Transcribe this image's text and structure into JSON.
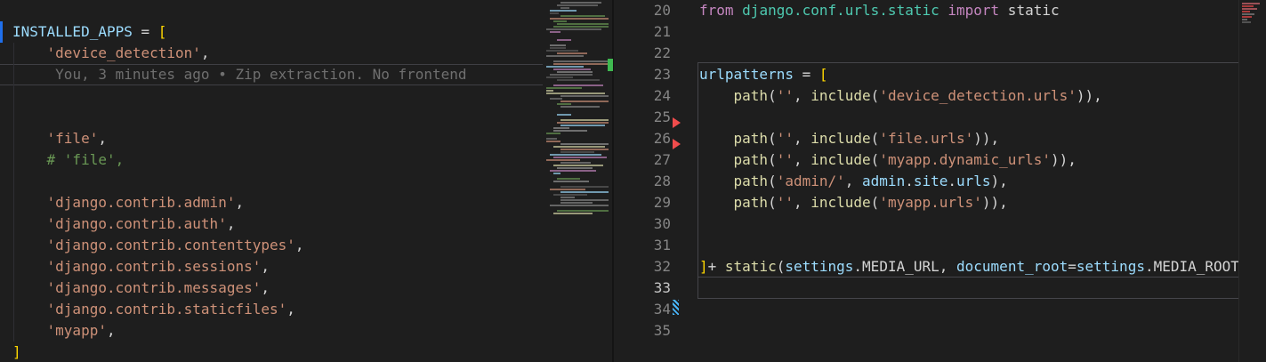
{
  "editor": {
    "background": "#1e1e1e",
    "colors": {
      "kw": "#C586C0",
      "str": "#CE9178",
      "com": "#6A9955",
      "var": "#9CDCFE",
      "fn": "#DCDCAA",
      "pn": "#D4D4D4",
      "br": "#FFD700",
      "mod": "#4EC9B0",
      "blame": "#6f6f6f",
      "line_number": "#858585",
      "line_number_active": "#C6C6C6",
      "git_added": "#3fb950",
      "git_modified": "#1f6feb",
      "git_deleted": "#f14c4c"
    },
    "left_pane": {
      "blame_text": "You, 3 minutes ago • Zip extraction. No frontend",
      "lines": [
        {
          "tokens": []
        },
        {
          "tokens": [
            [
              "INSTALLED_APPS",
              "var"
            ],
            [
              " = ",
              "pn"
            ],
            [
              "[",
              "br"
            ]
          ]
        },
        {
          "tokens": [
            [
              "    ",
              "pn"
            ],
            [
              "'device_detection'",
              "str"
            ],
            [
              ",",
              "pn"
            ]
          ]
        },
        {
          "cls": "current-line",
          "tokens": [
            [
              "     ",
              "pn"
            ],
            [
              "You, 3 minutes ago • Zip extraction. No frontend",
              "blame"
            ]
          ]
        },
        {
          "tokens": []
        },
        {
          "tokens": []
        },
        {
          "tokens": [
            [
              "    ",
              "pn"
            ],
            [
              "'file'",
              "str"
            ],
            [
              ",",
              "pn"
            ]
          ]
        },
        {
          "tokens": [
            [
              "    ",
              "pn"
            ],
            [
              "# 'file',",
              "com"
            ]
          ]
        },
        {
          "tokens": []
        },
        {
          "tokens": [
            [
              "    ",
              "pn"
            ],
            [
              "'django.contrib.admin'",
              "str"
            ],
            [
              ",",
              "pn"
            ]
          ]
        },
        {
          "tokens": [
            [
              "    ",
              "pn"
            ],
            [
              "'django.contrib.auth'",
              "str"
            ],
            [
              ",",
              "pn"
            ]
          ]
        },
        {
          "tokens": [
            [
              "    ",
              "pn"
            ],
            [
              "'django.contrib.contenttypes'",
              "str"
            ],
            [
              ",",
              "pn"
            ]
          ]
        },
        {
          "tokens": [
            [
              "    ",
              "pn"
            ],
            [
              "'django.contrib.sessions'",
              "str"
            ],
            [
              ",",
              "pn"
            ]
          ]
        },
        {
          "tokens": [
            [
              "    ",
              "pn"
            ],
            [
              "'django.contrib.messages'",
              "str"
            ],
            [
              ",",
              "pn"
            ]
          ]
        },
        {
          "tokens": [
            [
              "    ",
              "pn"
            ],
            [
              "'django.contrib.staticfiles'",
              "str"
            ],
            [
              ",",
              "pn"
            ]
          ]
        },
        {
          "tokens": [
            [
              "    ",
              "pn"
            ],
            [
              "'myapp'",
              "str"
            ],
            [
              ",",
              "pn"
            ]
          ]
        },
        {
          "tokens": [
            [
              "]",
              "br"
            ]
          ]
        }
      ]
    },
    "right_pane": {
      "current_line": 33,
      "deleted_marker_lines": [
        26,
        27
      ],
      "modified_marker_line": 34,
      "lines": [
        {
          "num": "20",
          "tokens": [
            [
              "from",
              "kw"
            ],
            [
              " ",
              "pn"
            ],
            [
              "django.conf.urls.static",
              "mod"
            ],
            [
              " ",
              "pn"
            ],
            [
              "import",
              "kw"
            ],
            [
              " static",
              "pn"
            ]
          ]
        },
        {
          "num": "21",
          "tokens": []
        },
        {
          "num": "22",
          "tokens": []
        },
        {
          "num": "23",
          "tokens": [
            [
              "urlpatterns",
              "var"
            ],
            [
              " = ",
              "pn"
            ],
            [
              "[",
              "br"
            ]
          ]
        },
        {
          "num": "24",
          "tokens": [
            [
              "    ",
              "pn"
            ],
            [
              "path",
              "fn"
            ],
            [
              "(",
              "pn"
            ],
            [
              "''",
              "str"
            ],
            [
              ", ",
              "pn"
            ],
            [
              "include",
              "fn"
            ],
            [
              "(",
              "pn"
            ],
            [
              "'device_detection.urls'",
              "str"
            ],
            [
              ")),",
              "pn"
            ]
          ]
        },
        {
          "num": "25",
          "tokens": []
        },
        {
          "num": "26",
          "tokens": [
            [
              "    ",
              "pn"
            ],
            [
              "path",
              "fn"
            ],
            [
              "(",
              "pn"
            ],
            [
              "''",
              "str"
            ],
            [
              ", ",
              "pn"
            ],
            [
              "include",
              "fn"
            ],
            [
              "(",
              "pn"
            ],
            [
              "'file.urls'",
              "str"
            ],
            [
              ")),",
              "pn"
            ]
          ]
        },
        {
          "num": "27",
          "tokens": [
            [
              "    ",
              "pn"
            ],
            [
              "path",
              "fn"
            ],
            [
              "(",
              "pn"
            ],
            [
              "''",
              "str"
            ],
            [
              ", ",
              "pn"
            ],
            [
              "include",
              "fn"
            ],
            [
              "(",
              "pn"
            ],
            [
              "'myapp.dynamic_urls'",
              "str"
            ],
            [
              ")),",
              "pn"
            ]
          ]
        },
        {
          "num": "28",
          "tokens": [
            [
              "    ",
              "pn"
            ],
            [
              "path",
              "fn"
            ],
            [
              "(",
              "pn"
            ],
            [
              "'admin/'",
              "str"
            ],
            [
              ", ",
              "pn"
            ],
            [
              "admin",
              "var"
            ],
            [
              ".",
              "pn"
            ],
            [
              "site",
              "var"
            ],
            [
              ".",
              "pn"
            ],
            [
              "urls",
              "var"
            ],
            [
              "),",
              "pn"
            ]
          ]
        },
        {
          "num": "29",
          "tokens": [
            [
              "    ",
              "pn"
            ],
            [
              "path",
              "fn"
            ],
            [
              "(",
              "pn"
            ],
            [
              "''",
              "str"
            ],
            [
              ", ",
              "pn"
            ],
            [
              "include",
              "fn"
            ],
            [
              "(",
              "pn"
            ],
            [
              "'myapp.urls'",
              "str"
            ],
            [
              ")),",
              "pn"
            ]
          ]
        },
        {
          "num": "30",
          "tokens": []
        },
        {
          "num": "31",
          "tokens": []
        },
        {
          "num": "32",
          "tokens": [
            [
              "]",
              "br"
            ],
            [
              "+ ",
              "pn"
            ],
            [
              "static",
              "fn"
            ],
            [
              "(",
              "pn"
            ],
            [
              "settings",
              "var"
            ],
            [
              ".",
              "pn"
            ],
            [
              "MEDIA_URL",
              "pn"
            ],
            [
              ", ",
              "pn"
            ],
            [
              "document_root",
              "var"
            ],
            [
              "=",
              "pn"
            ],
            [
              "settings",
              "var"
            ],
            [
              ".",
              "pn"
            ],
            [
              "MEDIA_ROOT",
              "pn"
            ]
          ]
        },
        {
          "num": "33",
          "current": true,
          "tokens": []
        },
        {
          "num": "34",
          "tokens": []
        },
        {
          "num": "35",
          "tokens": []
        }
      ]
    },
    "minimap_left": {
      "rows": 80,
      "seed": 987654321,
      "palette": [
        "#7d7d7d",
        "#9a9a9a",
        "#ce9178",
        "#9cdcfe",
        "#6a9955",
        "#c586c0",
        "#dcdcaa",
        "#5f5f5f",
        "#8a8a8a"
      ]
    },
    "minimap_right": {
      "rows": [
        {
          "w": 20,
          "c": "#e06c75"
        },
        {
          "w": 13,
          "c": "#f14c4c"
        },
        {
          "w": 17,
          "c": "#e06c75"
        },
        {
          "w": 9,
          "c": "#f14c4c"
        },
        {
          "w": 14,
          "c": "#8a8a8a"
        },
        {
          "w": 11,
          "c": "#f14c4c"
        },
        {
          "w": 6,
          "c": "#8a8a8a"
        },
        {
          "w": 10,
          "c": "#6f6f6f"
        }
      ]
    }
  }
}
